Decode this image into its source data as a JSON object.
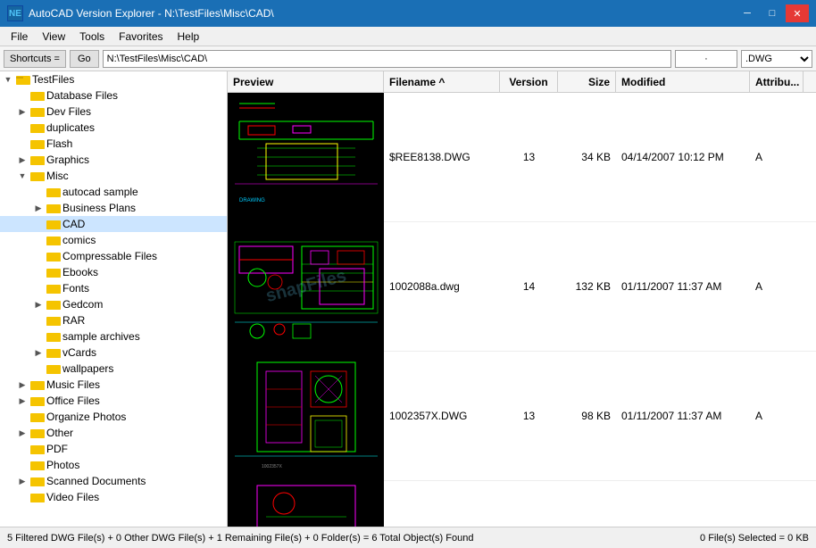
{
  "titleBar": {
    "appName": "NE",
    "title": "AutoCAD Version Explorer - N:\\TestFiles\\Misc\\CAD\\",
    "minimize": "─",
    "maximize": "□",
    "close": "✕"
  },
  "menuBar": {
    "items": [
      "File",
      "View",
      "Tools",
      "Favorites",
      "Help"
    ]
  },
  "addressBar": {
    "shortcutsLabel": "Shortcuts =",
    "goLabel": "Go",
    "address": "N:\\TestFiles\\Misc\\CAD\\",
    "filter": "·",
    "extension": ".DWG"
  },
  "columns": {
    "preview": "Preview",
    "filename": "Filename ^",
    "version": "Version",
    "size": "Size",
    "modified": "Modified",
    "attr": "Attribu..."
  },
  "tree": {
    "items": [
      {
        "label": "TestFiles",
        "level": 0,
        "expanded": true,
        "hasChildren": true
      },
      {
        "label": "Database Files",
        "level": 1,
        "expanded": false,
        "hasChildren": false
      },
      {
        "label": "Dev Files",
        "level": 1,
        "expanded": false,
        "hasChildren": true
      },
      {
        "label": "duplicates",
        "level": 1,
        "expanded": false,
        "hasChildren": false
      },
      {
        "label": "Flash",
        "level": 1,
        "expanded": false,
        "hasChildren": false
      },
      {
        "label": "Graphics",
        "level": 1,
        "expanded": false,
        "hasChildren": true
      },
      {
        "label": "Misc",
        "level": 1,
        "expanded": true,
        "hasChildren": true
      },
      {
        "label": "autocad sample",
        "level": 2,
        "expanded": false,
        "hasChildren": false
      },
      {
        "label": "Business Plans",
        "level": 2,
        "expanded": false,
        "hasChildren": true
      },
      {
        "label": "CAD",
        "level": 2,
        "expanded": false,
        "hasChildren": false,
        "selected": true
      },
      {
        "label": "comics",
        "level": 2,
        "expanded": false,
        "hasChildren": false
      },
      {
        "label": "Compressable Files",
        "level": 2,
        "expanded": false,
        "hasChildren": false
      },
      {
        "label": "Ebooks",
        "level": 2,
        "expanded": false,
        "hasChildren": false
      },
      {
        "label": "Fonts",
        "level": 2,
        "expanded": false,
        "hasChildren": false
      },
      {
        "label": "Gedcom",
        "level": 2,
        "expanded": false,
        "hasChildren": true
      },
      {
        "label": "RAR",
        "level": 2,
        "expanded": false,
        "hasChildren": false
      },
      {
        "label": "sample archives",
        "level": 2,
        "expanded": false,
        "hasChildren": false
      },
      {
        "label": "vCards",
        "level": 2,
        "expanded": false,
        "hasChildren": true
      },
      {
        "label": "wallpapers",
        "level": 2,
        "expanded": false,
        "hasChildren": false
      },
      {
        "label": "Music Files",
        "level": 1,
        "expanded": false,
        "hasChildren": true
      },
      {
        "label": "Office Files",
        "level": 1,
        "expanded": false,
        "hasChildren": true
      },
      {
        "label": "Organize Photos",
        "level": 1,
        "expanded": false,
        "hasChildren": false
      },
      {
        "label": "Other",
        "level": 1,
        "expanded": false,
        "hasChildren": true
      },
      {
        "label": "PDF",
        "level": 1,
        "expanded": false,
        "hasChildren": false
      },
      {
        "label": "Photos",
        "level": 1,
        "expanded": false,
        "hasChildren": false
      },
      {
        "label": "Scanned Documents",
        "level": 1,
        "expanded": false,
        "hasChildren": true
      },
      {
        "label": "Video Files",
        "level": 1,
        "expanded": false,
        "hasChildren": false
      }
    ]
  },
  "files": [
    {
      "name": "$REE8138.DWG",
      "version": "13",
      "size": "34 KB",
      "modified": "04/14/2007 10:12 PM",
      "attr": "A"
    },
    {
      "name": "1002088a.dwg",
      "version": "14",
      "size": "132 KB",
      "modified": "01/11/2007 11:37 AM",
      "attr": "A"
    },
    {
      "name": "1002357X.DWG",
      "version": "13",
      "size": "98 KB",
      "modified": "01/11/2007 11:37 AM",
      "attr": "A"
    }
  ],
  "statusBar": {
    "left": "5 Filtered DWG File(s) + 0 Other DWG File(s) + 1 Remaining File(s) + 0 Folder(s)  =  6 Total Object(s) Found",
    "right": "0 File(s) Selected = 0 KB"
  },
  "colors": {
    "titleBg": "#1a6fb5",
    "closeBg": "#e53935",
    "selectedBg": "#cce5ff",
    "folderYellow": "#f5c400",
    "folderDark": "#d4a800"
  }
}
